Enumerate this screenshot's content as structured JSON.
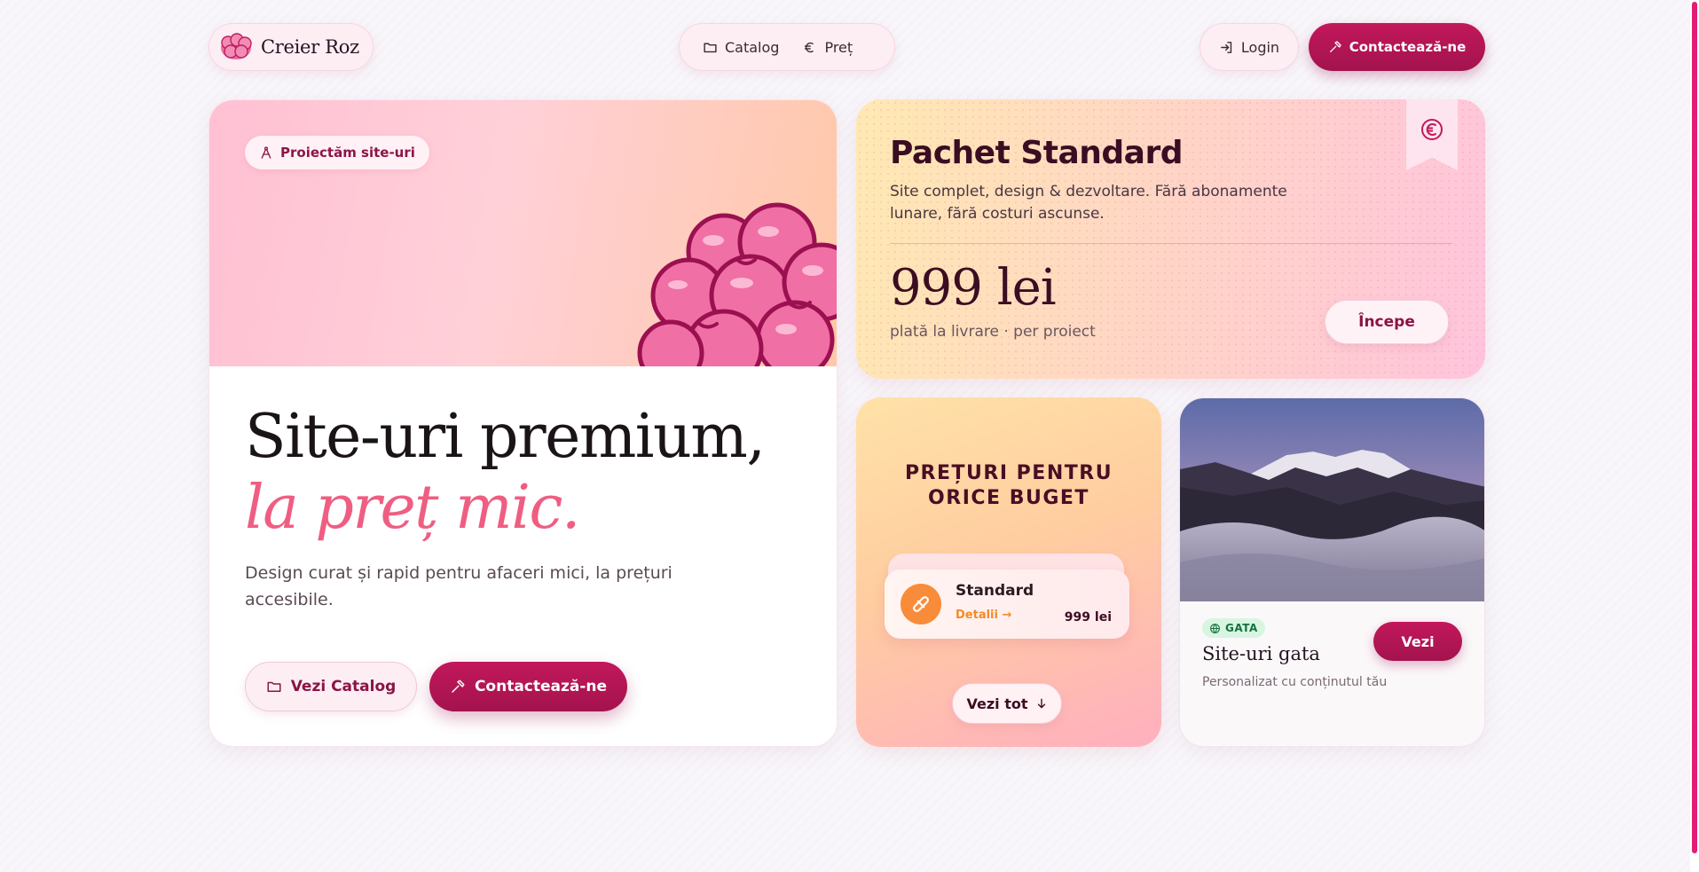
{
  "header": {
    "brand": "Creier Roz",
    "nav": [
      {
        "label": "Catalog",
        "icon": "folder-icon"
      },
      {
        "label": "Preț",
        "icon": "euro-icon"
      }
    ],
    "login_label": "Login",
    "contact_label": "Contactează-ne"
  },
  "hero": {
    "badge": "Proiectăm site-uri",
    "title_line1": "Site-uri premium,",
    "title_line2": "la preț mic.",
    "subtitle": "Design curat și rapid pentru afaceri mici, la prețuri accesibile.",
    "catalog_button": "Vezi Catalog",
    "contact_button": "Contactează-ne"
  },
  "package": {
    "title": "Pachet Standard",
    "description": "Site complet, design & dezvoltare. Fără abonamente lunare, fără costuri ascunse.",
    "price": "999 lei",
    "note": "plată la livrare · per proiect",
    "cta": "Începe"
  },
  "prices": {
    "title_line1": "PREȚURI PENTRU",
    "title_line2": "ORICE BUGET",
    "item_name": "Standard",
    "item_link": "Detalii →",
    "item_price": "999 lei",
    "see_all": "Vezi tot"
  },
  "ready": {
    "badge": "GATA",
    "title": "Site-uri gata",
    "subtitle": "Personalizat cu conținutul tău",
    "cta": "Vezi"
  },
  "colors": {
    "accent": "#c2185b",
    "pink_text": "#ef5e82",
    "dark": "#3b0d22"
  }
}
